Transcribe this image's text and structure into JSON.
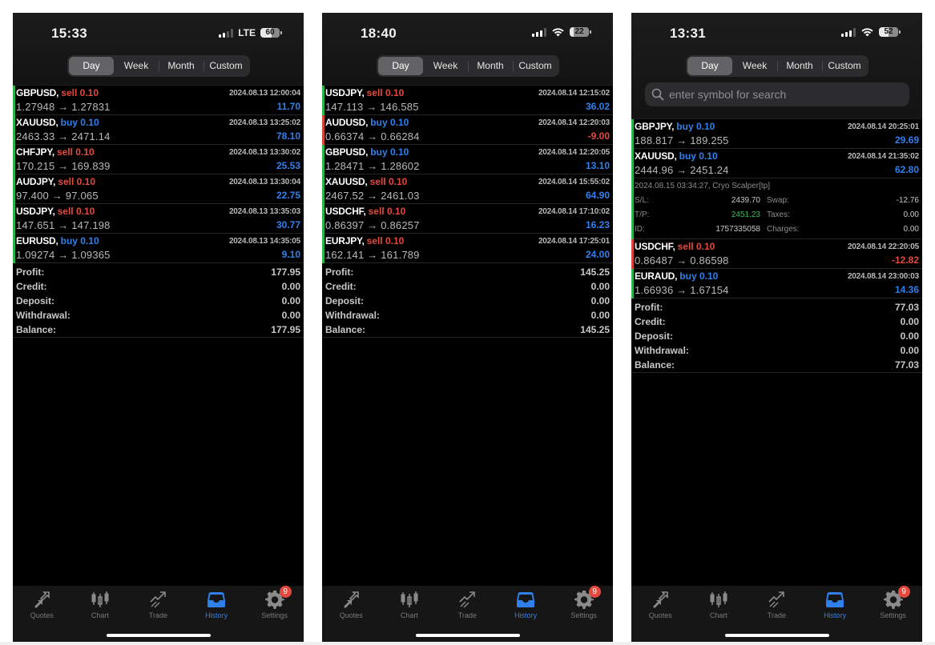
{
  "colors": {
    "sell": "#e5483d",
    "buy": "#2f80ed",
    "positive_profit": "#2f80ed",
    "negative_profit": "#e5483d",
    "edge_positive": "#2cb34a",
    "edge_negative": "#d9443a",
    "active_tab": "#2f80ed"
  },
  "screens": [
    {
      "status": {
        "time": "15:33",
        "network": "LTE",
        "battery": "60",
        "signal_bars": 2,
        "wifi": false
      },
      "period_tabs": [
        {
          "label": "Day",
          "active": true
        },
        {
          "label": "Week",
          "active": false
        },
        {
          "label": "Month",
          "active": false
        },
        {
          "label": "Custom",
          "active": false
        }
      ],
      "search_placeholder": null,
      "deals": [
        {
          "symbol": "GBPUSD,",
          "side": "sell",
          "volume": "0.10",
          "action": "sell 0.10",
          "time": "2024.08.13 12:00:04",
          "prices": "1.27948 → 1.27831",
          "profit": "11.70"
        },
        {
          "symbol": "XAUUSD,",
          "side": "buy",
          "volume": "0.10",
          "action": "buy 0.10",
          "time": "2024.08.13 13:25:02",
          "prices": "2463.33 → 2471.14",
          "profit": "78.10"
        },
        {
          "symbol": "CHFJPY,",
          "side": "sell",
          "volume": "0.10",
          "action": "sell 0.10",
          "time": "2024.08.13 13:30:02",
          "prices": "170.215 → 169.839",
          "profit": "25.53"
        },
        {
          "symbol": "AUDJPY,",
          "side": "sell",
          "volume": "0.10",
          "action": "sell 0.10",
          "time": "2024.08.13 13:30:04",
          "prices": "97.400 → 97.065",
          "profit": "22.75"
        },
        {
          "symbol": "USDJPY,",
          "side": "sell",
          "volume": "0.10",
          "action": "sell 0.10",
          "time": "2024.08.13 13:35:03",
          "prices": "147.651 → 147.198",
          "profit": "30.77"
        },
        {
          "symbol": "EURUSD,",
          "side": "buy",
          "volume": "0.10",
          "action": "buy 0.10",
          "time": "2024.08.13 14:35:05",
          "prices": "1.09274 → 1.09365",
          "profit": "9.10"
        }
      ],
      "summary": [
        {
          "label": "Profit:",
          "value": "177.95"
        },
        {
          "label": "Credit:",
          "value": "0.00"
        },
        {
          "label": "Deposit:",
          "value": "0.00"
        },
        {
          "label": "Withdrawal:",
          "value": "0.00"
        },
        {
          "label": "Balance:",
          "value": "177.95"
        }
      ]
    },
    {
      "status": {
        "time": "18:40",
        "network": null,
        "battery": "22",
        "signal_bars": 3,
        "wifi": true
      },
      "period_tabs": [
        {
          "label": "Day",
          "active": true
        },
        {
          "label": "Week",
          "active": false
        },
        {
          "label": "Month",
          "active": false
        },
        {
          "label": "Custom",
          "active": false
        }
      ],
      "search_placeholder": null,
      "deals": [
        {
          "symbol": "USDJPY,",
          "side": "sell",
          "volume": "0.10",
          "action": "sell 0.10",
          "time": "2024.08.14 12:15:02",
          "prices": "147.113 → 146.585",
          "profit": "36.02"
        },
        {
          "symbol": "AUDUSD,",
          "side": "buy",
          "volume": "0.10",
          "action": "buy 0.10",
          "time": "2024.08.14 12:20:03",
          "prices": "0.66374 → 0.66284",
          "profit": "-9.00"
        },
        {
          "symbol": "GBPUSD,",
          "side": "buy",
          "volume": "0.10",
          "action": "buy 0.10",
          "time": "2024.08.14 12:20:05",
          "prices": "1.28471 → 1.28602",
          "profit": "13.10"
        },
        {
          "symbol": "XAUUSD,",
          "side": "sell",
          "volume": "0.10",
          "action": "sell 0.10",
          "time": "2024.08.14 15:55:02",
          "prices": "2467.52 → 2461.03",
          "profit": "64.90"
        },
        {
          "symbol": "USDCHF,",
          "side": "sell",
          "volume": "0.10",
          "action": "sell 0.10",
          "time": "2024.08.14 17:10:02",
          "prices": "0.86397 → 0.86257",
          "profit": "16.23"
        },
        {
          "symbol": "EURJPY,",
          "side": "sell",
          "volume": "0.10",
          "action": "sell 0.10",
          "time": "2024.08.14 17:25:01",
          "prices": "162.141 → 161.789",
          "profit": "24.00"
        }
      ],
      "summary": [
        {
          "label": "Profit:",
          "value": "145.25"
        },
        {
          "label": "Credit:",
          "value": "0.00"
        },
        {
          "label": "Deposit:",
          "value": "0.00"
        },
        {
          "label": "Withdrawal:",
          "value": "0.00"
        },
        {
          "label": "Balance:",
          "value": "145.25"
        }
      ]
    },
    {
      "status": {
        "time": "13:31",
        "network": null,
        "battery": "52",
        "signal_bars": 3,
        "wifi": true
      },
      "period_tabs": [
        {
          "label": "Day",
          "active": true
        },
        {
          "label": "Week",
          "active": false
        },
        {
          "label": "Month",
          "active": false
        },
        {
          "label": "Custom",
          "active": false
        }
      ],
      "search_placeholder": "enter symbol for search",
      "deals": [
        {
          "symbol": "GBPJPY,",
          "side": "buy",
          "volume": "0.10",
          "action": "buy 0.10",
          "time": "2024.08.14 20:25:01",
          "prices": "188.817 → 189.255",
          "profit": "29.69"
        },
        {
          "symbol": "XAUUSD,",
          "side": "buy",
          "volume": "0.10",
          "action": "buy 0.10",
          "time": "2024.08.14 21:35:02",
          "prices": "2444.96 → 2451.24",
          "profit": "62.80",
          "details": {
            "meta": "2024.08.15 03:34:27, Cryo Scalper[tp]",
            "rows": [
              {
                "k1": "S/L:",
                "v1": "2439.70",
                "k2": "Swap:",
                "v2": "-12.76",
                "v1_green": false
              },
              {
                "k1": "T/P:",
                "v1": "2451.23",
                "k2": "Taxes:",
                "v2": "0.00",
                "v1_green": true
              },
              {
                "k1": "ID:",
                "v1": "1757335058",
                "k2": "Charges:",
                "v2": "0.00",
                "v1_green": false
              }
            ]
          }
        },
        {
          "symbol": "USDCHF,",
          "side": "sell",
          "volume": "0.10",
          "action": "sell 0.10",
          "time": "2024.08.14 22:20:05",
          "prices": "0.86487 → 0.86598",
          "profit": "-12.82"
        },
        {
          "symbol": "EURAUD,",
          "side": "buy",
          "volume": "0.10",
          "action": "buy 0.10",
          "time": "2024.08.14 23:00:03",
          "prices": "1.66936 → 1.67154",
          "profit": "14.36"
        }
      ],
      "summary": [
        {
          "label": "Profit:",
          "value": "77.03"
        },
        {
          "label": "Credit:",
          "value": "0.00"
        },
        {
          "label": "Deposit:",
          "value": "0.00"
        },
        {
          "label": "Withdrawal:",
          "value": "0.00"
        },
        {
          "label": "Balance:",
          "value": "77.03"
        }
      ]
    }
  ],
  "tabbar": [
    {
      "label": "Quotes",
      "icon": "quotes-arrows-icon",
      "active": false,
      "badge": null
    },
    {
      "label": "Chart",
      "icon": "candlestick-chart-icon",
      "active": false,
      "badge": null
    },
    {
      "label": "Trade",
      "icon": "trade-trend-icon",
      "active": false,
      "badge": null
    },
    {
      "label": "History",
      "icon": "inbox-tray-icon",
      "active": true,
      "badge": null
    },
    {
      "label": "Settings",
      "icon": "gear-icon",
      "active": false,
      "badge": "9"
    }
  ]
}
